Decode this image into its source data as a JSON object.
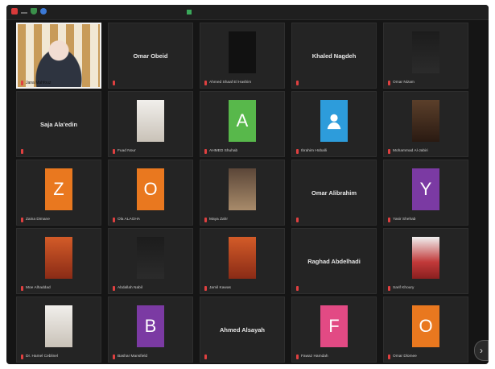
{
  "app": {
    "title": ""
  },
  "colors": {
    "accent_orange": "#e9781f",
    "accent_purple": "#7b3aa3",
    "accent_green": "#58b84b",
    "accent_pink": "#e24a84",
    "accent_blue": "#2d9cdb",
    "mic_red": "#e04040"
  },
  "grid": {
    "rows": [
      [
        {
          "id": "t00",
          "kind": "featured",
          "label": "Jana Mahfouz"
        },
        {
          "id": "t01",
          "kind": "name",
          "name": "Omar Obeid",
          "label": ""
        },
        {
          "id": "t02",
          "kind": "photo",
          "photo": "p-logo",
          "label": "Ahmed Shaaf El Hashim"
        },
        {
          "id": "t03",
          "kind": "name",
          "name": "Khaled Nagdeh",
          "label": ""
        },
        {
          "id": "t04",
          "kind": "photo",
          "photo": "p-dark",
          "label": "Omar Nizam"
        }
      ],
      [
        {
          "id": "t10",
          "kind": "name",
          "name": "Saja Ala'edin",
          "label": ""
        },
        {
          "id": "t11",
          "kind": "photo",
          "photo": "p-white",
          "label": "Fuad Nour"
        },
        {
          "id": "t12",
          "kind": "letter",
          "letter": "A",
          "bg": "#58b84b",
          "label": "AHMED Shuhab"
        },
        {
          "id": "t13",
          "kind": "icon",
          "bg": "#2d9cdb",
          "label": "Ibrahim Hoballi"
        },
        {
          "id": "t14",
          "kind": "photo",
          "photo": "p-glass",
          "label": "Mohammad Al-Jabiri"
        }
      ],
      [
        {
          "id": "t20",
          "kind": "letter",
          "letter": "Z",
          "bg": "#e9781f",
          "label": "Zaina Dimane"
        },
        {
          "id": "t21",
          "kind": "letter",
          "letter": "O",
          "bg": "#e9781f",
          "label": "Ola ALAGHA"
        },
        {
          "id": "t22",
          "kind": "photo",
          "photo": "p-road",
          "label": "Maya Zahr"
        },
        {
          "id": "t23",
          "kind": "name",
          "name": "Omar Alibrahim",
          "label": ""
        },
        {
          "id": "t24",
          "kind": "letter",
          "letter": "Y",
          "bg": "#7b3aa3",
          "label": "Yasir Shehab"
        }
      ],
      [
        {
          "id": "t30",
          "kind": "photo",
          "photo": "p-warm",
          "label": "Moe Alhaddad"
        },
        {
          "id": "t31",
          "kind": "photo",
          "photo": "p-dark",
          "label": "Abdallah Nabil"
        },
        {
          "id": "t32",
          "kind": "photo",
          "photo": "p-warm",
          "label": "Jamil Kawas"
        },
        {
          "id": "t33",
          "kind": "name",
          "name": "Raghad Abdelhadi",
          "label": ""
        },
        {
          "id": "t34",
          "kind": "photo",
          "photo": "p-red",
          "label": "Sarif Khoury"
        }
      ],
      [
        {
          "id": "t40",
          "kind": "photo",
          "photo": "p-white",
          "label": "Dr. Hamel Ceblinel"
        },
        {
          "id": "t41",
          "kind": "letter",
          "letter": "B",
          "bg": "#7b3aa3",
          "label": "Bashar Mansfield"
        },
        {
          "id": "t42",
          "kind": "name",
          "name": "Ahmed Alsayah",
          "label": ""
        },
        {
          "id": "t43",
          "kind": "letter",
          "letter": "F",
          "bg": "#e24a84",
          "label": "Fawaz Hamdah"
        },
        {
          "id": "t44",
          "kind": "letter",
          "letter": "O",
          "bg": "#e9781f",
          "label": "Omar Dlomee"
        }
      ]
    ]
  },
  "nav": {
    "next_label": "›"
  }
}
